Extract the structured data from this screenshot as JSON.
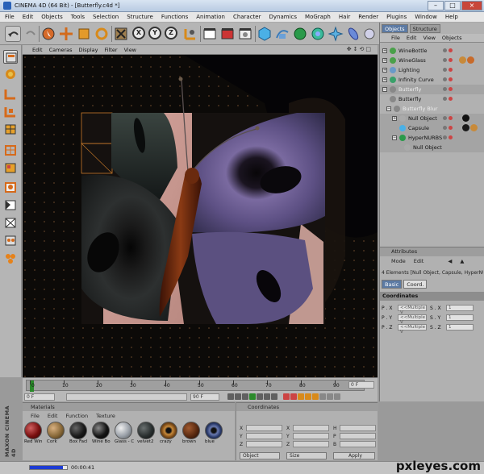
{
  "window": {
    "title": "CINEMA 4D (64 Bit) - [Butterfly.c4d *]"
  },
  "menubar": [
    "File",
    "Edit",
    "Objects",
    "Tools",
    "Selection",
    "Structure",
    "Functions",
    "Animation",
    "Character",
    "Dynamics",
    "MoGraph",
    "Hair",
    "Render",
    "Plugins",
    "Window",
    "Help"
  ],
  "viewport": {
    "menu": [
      "Edit",
      "Cameras",
      "Display",
      "Filter",
      "View"
    ]
  },
  "objects": {
    "tabs": [
      "Objects",
      "Structure"
    ],
    "menu": [
      "File",
      "Edit",
      "View",
      "Objects"
    ],
    "items": [
      {
        "label": "WineBottle"
      },
      {
        "label": "WineGlass"
      },
      {
        "label": "Lighting"
      },
      {
        "label": "Infinity Curve"
      },
      {
        "label": "Butterfly"
      },
      {
        "label": "Butterfly"
      },
      {
        "label": "Butterfly Blur"
      },
      {
        "label": "Null Object"
      },
      {
        "label": "Capsule"
      },
      {
        "label": "HyperNURBS"
      },
      {
        "label": "Null Object"
      }
    ]
  },
  "attributes": {
    "header": "Attributes",
    "menu": [
      "Mode",
      "Edit"
    ],
    "info": "4 Elements [Null Object, Capsule, HyperNURBS]",
    "tabs": [
      "Basic",
      "Coord."
    ],
    "section": "Coordinates",
    "rows": [
      {
        "axis": "P . X",
        "value": "<<Multiple V",
        "saxis": "S . X",
        "svalue": "1"
      },
      {
        "axis": "P . Y",
        "value": "<<Multiple V",
        "saxis": "S . Y",
        "svalue": "1"
      },
      {
        "axis": "P . Z",
        "value": "<<Multiple V",
        "saxis": "S . Z",
        "svalue": "1"
      }
    ]
  },
  "timeline": {
    "ticks": [
      "0",
      "10",
      "20",
      "30",
      "40",
      "50",
      "60",
      "70",
      "80",
      "90"
    ],
    "end_field": "0 F",
    "start_field": "0 F",
    "max_field": "90 F"
  },
  "materials": {
    "header": "Materials",
    "menu": [
      "File",
      "Edit",
      "Function",
      "Texture"
    ],
    "items": [
      {
        "label": "Red Win",
        "color": "#7a1010"
      },
      {
        "label": "Cork",
        "color": "#8a6a3a"
      },
      {
        "label": "Box Facl",
        "color": "#1a1a1a"
      },
      {
        "label": "Wine Bo",
        "color": "#151515"
      },
      {
        "label": "Glass - C",
        "color": "#9aa0a8"
      },
      {
        "label": "velvet2",
        "color": "#2a3030"
      },
      {
        "label": "crazy",
        "color": "#7a4a18"
      },
      {
        "label": "brown",
        "color": "#5a2a10"
      },
      {
        "label": "blue",
        "color": "#2a3a6a"
      }
    ]
  },
  "coordinates": {
    "header": "Coordinates",
    "col1": [
      "X",
      "Y",
      "Z"
    ],
    "col2": [
      "X",
      "Y",
      "Z"
    ],
    "col3": [
      "H",
      "P",
      "B"
    ],
    "buttons": [
      "Object",
      "Size",
      "Apply"
    ]
  },
  "brand": "MAXON CINEMA 4D",
  "status": {
    "time": "00:00:41",
    "progress": 0.9
  },
  "watermark": "pxleyes.com"
}
